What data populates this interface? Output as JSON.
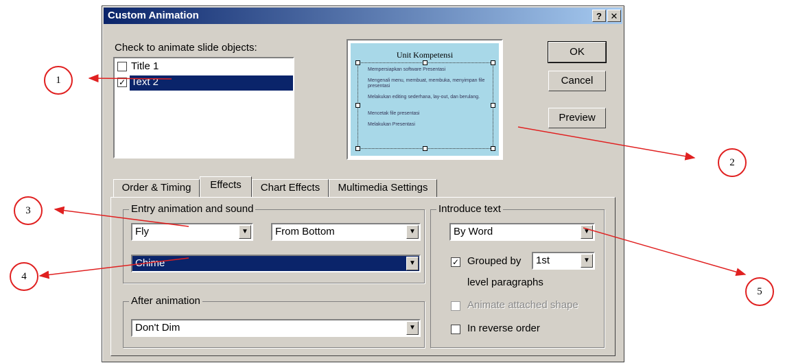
{
  "window": {
    "title": "Custom Animation",
    "help_btn": "?",
    "close_btn": "✕"
  },
  "objects": {
    "label": "Check to animate slide objects:",
    "items": [
      {
        "label": "Title 1",
        "checked": false
      },
      {
        "label": "Text 2",
        "checked": true
      }
    ]
  },
  "preview_slide": {
    "title": "Unit Kompetensi",
    "bullets": [
      "Mempersiapkan software Presentasi",
      "Mengenali menu, membuat, membuka, menyimpan file presentasi",
      "Melakukan editing sederhana, lay-out, dan berulang.",
      "Mencetak file presentasi",
      "Melakukan Presentasi"
    ]
  },
  "buttons": {
    "ok": "OK",
    "cancel": "Cancel",
    "preview": "Preview"
  },
  "tabs": [
    "Order & Timing",
    "Effects",
    "Chart Effects",
    "Multimedia Settings"
  ],
  "effects": {
    "entry_group": "Entry animation and sound",
    "entry_effect": "Fly",
    "entry_direction": "From Bottom",
    "sound": "Chime",
    "after_group": "After animation",
    "after_value": "Don't Dim",
    "introduce_group": "Introduce text",
    "introduce_value": "By Word",
    "grouped_label": "Grouped by",
    "grouped_value": "1st",
    "level_label": "level paragraphs",
    "attached_label": "Animate attached shape",
    "reverse_label": "In reverse order"
  },
  "callouts": [
    "1",
    "2",
    "3",
    "4",
    "5"
  ],
  "colors": {
    "accent": "#0a246a",
    "callout": "#e02020",
    "face": "#d4d0c8"
  }
}
